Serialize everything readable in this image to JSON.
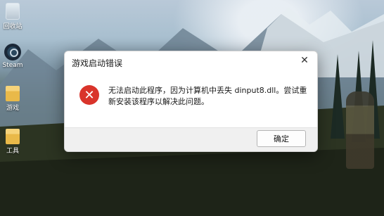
{
  "desktop": {
    "icons": [
      {
        "label": "回收站",
        "icon": "recycle-bin-icon"
      },
      {
        "label": "Steam",
        "icon": "steam-icon"
      },
      {
        "label": "游戏",
        "icon": "folder-icon"
      },
      {
        "label": "工具",
        "icon": "folder-icon"
      }
    ]
  },
  "dialog": {
    "title": "游戏启动错误",
    "close_symbol": "✕",
    "icon": "error-icon",
    "error_symbol": "✕",
    "message": "无法启动此程序，因为计算机中丢失 dinput8.dll。尝试重新安装该程序以解决此问题。",
    "ok_label": "确定"
  },
  "colors": {
    "error_red": "#d9342b",
    "dialog_bg": "#ffffff",
    "footer_bg": "#f0f0f0"
  }
}
